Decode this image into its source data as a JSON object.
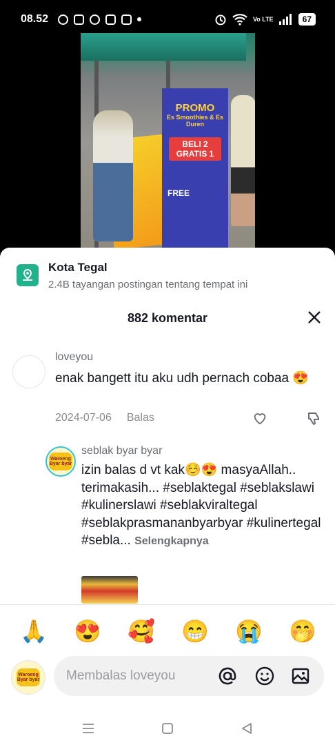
{
  "status_bar": {
    "time": "08.52",
    "network_label": "Vo LTE",
    "battery": "67"
  },
  "place": {
    "title": "Kota Tegal",
    "subtitle": "2.4B tayangan postingan tentang tempat ini"
  },
  "comments_header": {
    "title": "882 komentar"
  },
  "video": {
    "promo_title": "PROMO",
    "promo_subtitle": "Es Smoothies & Es Duren",
    "promo_offer": "BELI 2 GRATIS 1",
    "promo_free": "FREE"
  },
  "comment": {
    "username": "loveyou",
    "text": "enak bangett itu aku udh pernach cobaa 😍",
    "date": "2024-07-06",
    "reply_label": "Balas"
  },
  "reply": {
    "username": "seblak byar byar",
    "avatar_text": "Waroeng Byar byar",
    "text": "izin balas d vt kak☺️😍  masyaAllah.. terimakasih...  #seblaktegal #seblakslawi #kulinerslawi #seblakviraltegal #seblakprasmananbyarbyar #kulinertegal #sebla...",
    "more_label": "Selengkapnya"
  },
  "emojis": [
    "🙏",
    "😍",
    "🥰",
    "😁",
    "😭",
    "🤭"
  ],
  "input": {
    "placeholder": "Membalas loveyou"
  }
}
